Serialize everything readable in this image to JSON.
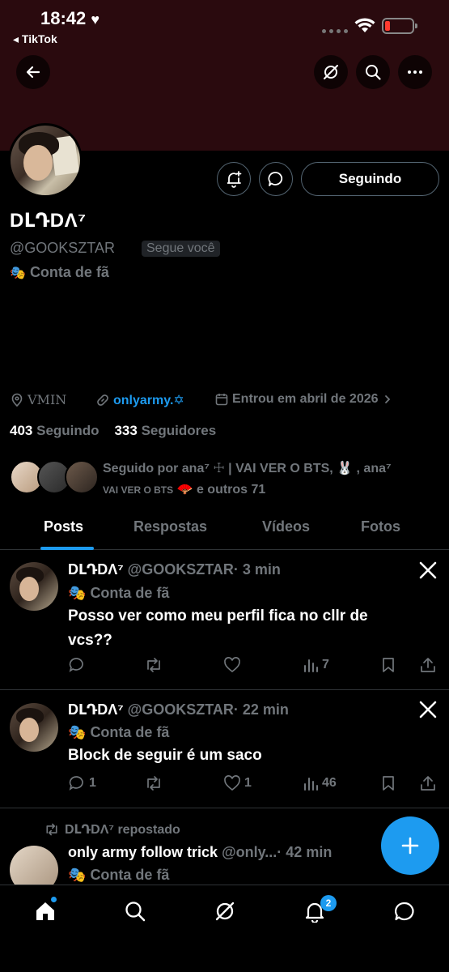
{
  "status_bar": {
    "time": "18:42",
    "heart": "♥",
    "back_app": "◂ TikTok"
  },
  "header": {
    "back_icon": "arrow-left-icon",
    "grok_icon": "grok-icon",
    "search_icon": "search-icon",
    "more_icon": "more-icon"
  },
  "profile": {
    "display_name": "DԼԴDΛ⁷",
    "handle": "@GOOKSZTAR",
    "follows_you": "Segue você",
    "fan_account": "Conta de fã",
    "following_button": "Seguindo",
    "location": "VMIN",
    "link": "onlyarmy.✡",
    "joined": "Entrou em abril de 2026",
    "following_count": "403",
    "following_label": "Seguindo",
    "followers_count": "333",
    "followers_label": "Seguidores",
    "followed_by_line1": "Seguido por ana⁷ ☩ | VAI VER O BTS, 🐰 , ana⁷",
    "followed_by_line2_small": "VAI VER O BTS",
    "followed_by_line2_rest": "🪭 e outros 71"
  },
  "tabs": [
    {
      "label": "Posts"
    },
    {
      "label": "Respostas"
    },
    {
      "label": "Vídeos"
    },
    {
      "label": "Fotos"
    }
  ],
  "posts": [
    {
      "name": "DԼԴDΛ⁷",
      "handle": "@GOOKSZTAR",
      "time": "· 3 min",
      "sub": "Conta de fã",
      "text": "Posso ver como meu perfil fica no cllr de vcs??",
      "replies": "",
      "reposts": "",
      "likes": "",
      "views": "7"
    },
    {
      "name": "DԼԴDΛ⁷",
      "handle": "@GOOKSZTAR",
      "time": "· 22 min",
      "sub": "Conta de fã",
      "text": "Block de seguir é um saco",
      "replies": "1",
      "reposts": "",
      "likes": "1",
      "views": "46"
    },
    {
      "reposted_by": "DԼԴDΛ⁷ repostado",
      "name": "only army follow trick",
      "handle": "@only...",
      "time": "· 42 min",
      "sub": "Conta de fã"
    }
  ],
  "notifications_badge": "2",
  "colors": {
    "accent": "#1d9bf0",
    "banner": "#2a0a0e",
    "muted": "#71767b"
  }
}
